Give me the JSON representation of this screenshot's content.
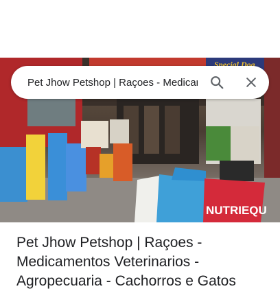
{
  "search": {
    "query": "Pet Jhow Petshop | Raçoes - Medicamentos Veterinarios - Agropecuaria - Cachorros e Gatos"
  },
  "result": {
    "title": "Pet Jhow Petshop | Raçoes - Medicamentos Veterinarios - Agropecuaria - Cachorros e Gatos"
  },
  "photo": {
    "sign_text": "Special Dog",
    "bag_text": "NUTRIEQU"
  },
  "icons": {
    "search": "search-icon",
    "close": "close-icon"
  },
  "colors": {
    "text": "#202124",
    "icon": "#5f6368"
  }
}
